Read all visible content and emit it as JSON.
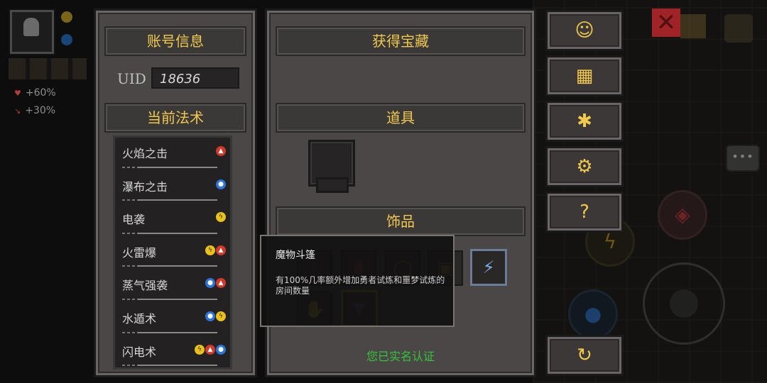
{
  "account_panel": {
    "title": "账号信息",
    "uid_label": "UID",
    "uid_value": "18636",
    "spell_title": "当前法术",
    "spells": [
      {
        "name": "火焰之击",
        "elements": [
          "fire"
        ]
      },
      {
        "name": "瀑布之击",
        "elements": [
          "water"
        ]
      },
      {
        "name": "电袭",
        "elements": [
          "thunder"
        ]
      },
      {
        "name": "火雷爆",
        "elements": [
          "thunder",
          "fire"
        ]
      },
      {
        "name": "蒸气强袭",
        "elements": [
          "water",
          "fire"
        ]
      },
      {
        "name": "水遁术",
        "elements": [
          "water",
          "thunder"
        ]
      },
      {
        "name": "闪电术",
        "elements": [
          "thunder",
          "fire",
          "water"
        ]
      }
    ]
  },
  "treasure_panel": {
    "title": "获得宝藏",
    "items_title": "道具",
    "accessories_title": "饰品",
    "realname_text": "您已实名认证"
  },
  "tooltip": {
    "title": "魔物斗篷",
    "description": "有100%几率额外增加勇者试炼和噩梦试炼的房间数量"
  },
  "hud": {
    "stat_1": "+60%",
    "stat_2": "+30%"
  },
  "side_buttons": [
    {
      "name": "support-button",
      "icon": "headset-icon"
    },
    {
      "name": "gift-button",
      "icon": "gift-icon"
    },
    {
      "name": "community-button",
      "icon": "bee-icon"
    },
    {
      "name": "settings-button",
      "icon": "gear-icon"
    },
    {
      "name": "help-button",
      "icon": "question-book-icon"
    },
    {
      "name": "refresh-button",
      "icon": "refresh-icon"
    }
  ],
  "element_icons": {
    "fire": "fire-icon",
    "water": "water-drop-icon",
    "thunder": "lightning-icon"
  },
  "colors": {
    "header_text": "#f2c94c",
    "realname_text": "#35c43a",
    "fire": "#d13a2a",
    "water": "#2e74d6",
    "thunder": "#e8c21b"
  }
}
